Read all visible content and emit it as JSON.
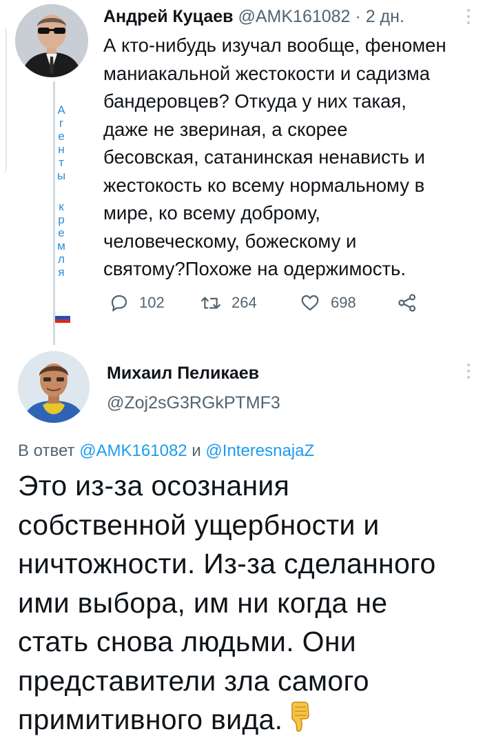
{
  "tweet1": {
    "author_name": "Андрей Куцаев",
    "handle": "@AMK161082",
    "separator": "·",
    "time": "2 дн.",
    "text": "А кто-нибудь изучал вообще, феномен\nманиакальной жестокости и садизма\nбандеровцев? Откуда у них такая,\nдаже не звериная, а скорее\nбесовская, сатанинская ненависть и\nжестокость ко всему нормальному в\nмире, ко всему доброму,\nчеловеческому, божескому и\nсвятому?Похоже на одержимость.",
    "avatar_side_text": [
      "А",
      "г",
      "е",
      "н",
      "т",
      "ы",
      "",
      "к",
      "р",
      "е",
      "м",
      "л",
      "я"
    ],
    "reply_count": "102",
    "retweet_count": "264",
    "like_count": "698"
  },
  "tweet2": {
    "author_name": "Михаил Пеликаев",
    "handle": "@Zoj2sG3RGkPTMF3",
    "reply_prefix": "В ответ",
    "reply_mention_1": "@AMK161082",
    "reply_and": "и",
    "reply_mention_2": "@InteresnajaZ",
    "text": "Это из-за осознания\nсобственной ущербности и\nничтожности. Из-за сделанного\nими выбора, им ни когда не\nстать снова людьми. Они\nпредставители зла самого\nпримитивного вида."
  },
  "colors": {
    "link": "#1d9bf0",
    "secondary_text": "#536471",
    "side_tag": "#2a8dd8",
    "thread_line": "#cfd9de"
  },
  "icons": [
    "reply-icon",
    "retweet-icon",
    "like-icon",
    "share-icon",
    "more-icon",
    "thumbs-down-icon",
    "russia-flag-icon"
  ]
}
